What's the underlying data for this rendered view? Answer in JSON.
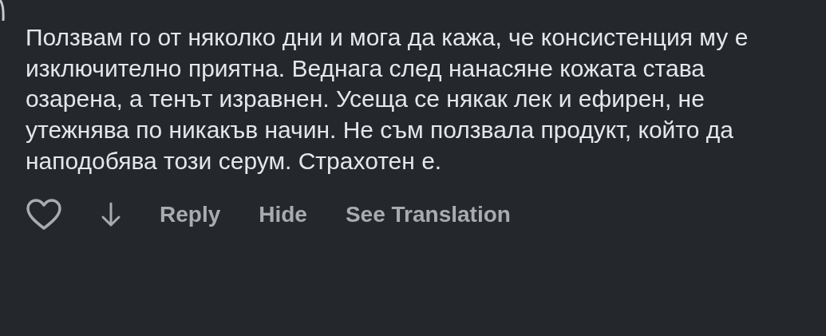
{
  "comment": {
    "text": "Ползвам го от няколко дни и мога да кажа, че консистенция му е изключително приятна. Веднага след нанасяне кожата става озарена, а тенът изравнен. Усеща се някак лек и ефирен, не утежнява по никакъв начин. Не съм ползвала продукт, който да наподобява този серум. Страхотен е.",
    "liked": false
  },
  "actions": [
    {
      "kind": "like"
    },
    {
      "kind": "downvote"
    },
    {
      "kind": "text",
      "label": "Reply"
    },
    {
      "kind": "text",
      "label": "Hide"
    },
    {
      "kind": "text",
      "label": "See Translation"
    }
  ]
}
